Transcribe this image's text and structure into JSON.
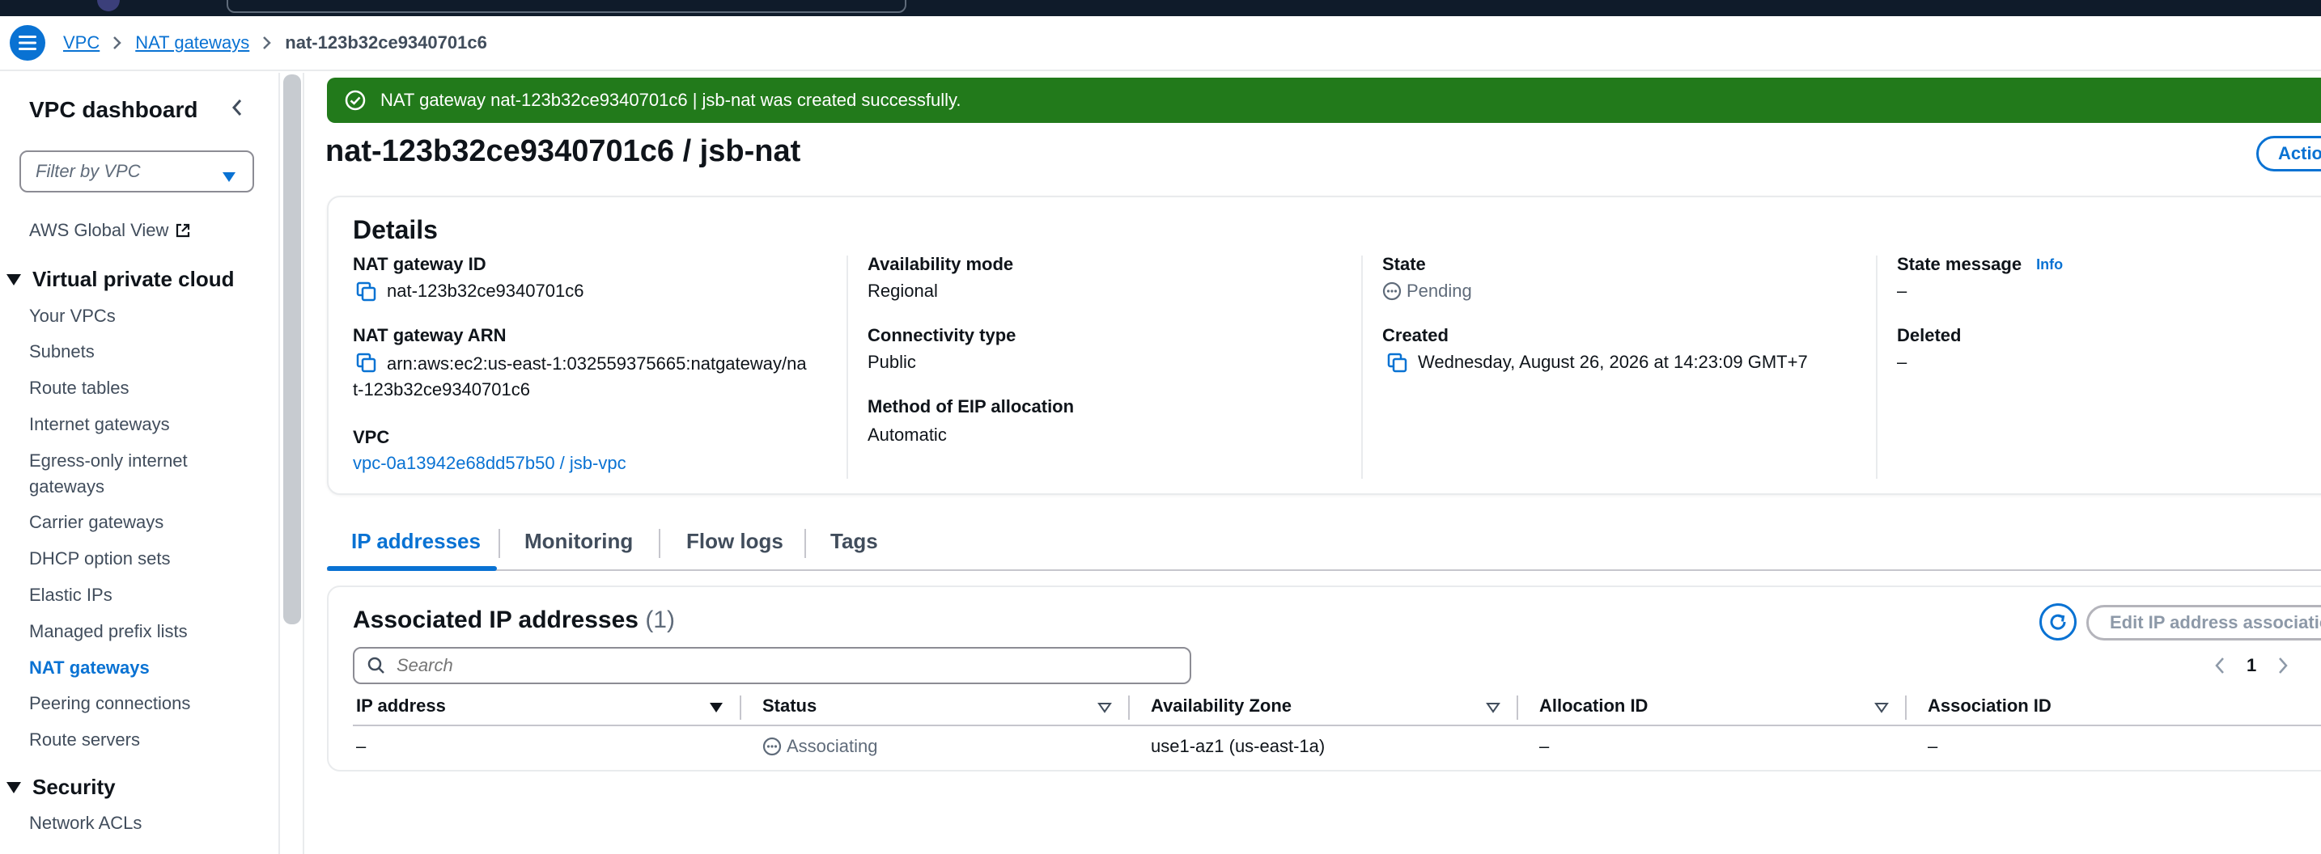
{
  "breadcrumb": {
    "items": [
      "VPC",
      "NAT gateways"
    ],
    "current": "nat-123b32ce9340701c6"
  },
  "sidebar": {
    "title": "VPC dashboard",
    "filter_placeholder": "Filter by VPC",
    "global_view": "AWS Global View",
    "section_vpc": "Virtual private cloud",
    "items": [
      "Your VPCs",
      "Subnets",
      "Route tables",
      "Internet gateways",
      "Egress-only internet",
      "gateways",
      "Carrier gateways",
      "DHCP option sets",
      "Elastic IPs",
      "Managed prefix lists",
      "NAT gateways",
      "Peering connections",
      "Route servers"
    ],
    "section_security": "Security",
    "security_items": [
      "Network ACLs"
    ]
  },
  "flash": {
    "message": "NAT gateway nat-123b32ce9340701c6 | jsb-nat was created successfully."
  },
  "page": {
    "title": "nat-123b32ce9340701c6 / jsb-nat",
    "actions_label": "Actio"
  },
  "details": {
    "title": "Details",
    "nat_id_label": "NAT gateway ID",
    "nat_id": "nat-123b32ce9340701c6",
    "arn_label": "NAT gateway ARN",
    "arn_line1": "arn:aws:ec2:us-east-1:032559375665:natgateway/na",
    "arn_line2": "t-123b32ce9340701c6",
    "vpc_label": "VPC",
    "vpc": "vpc-0a13942e68dd57b50 / jsb-vpc",
    "availability_mode_label": "Availability mode",
    "availability_mode": "Regional",
    "connectivity_label": "Connectivity type",
    "connectivity": "Public",
    "eip_label": "Method of EIP allocation",
    "eip": "Automatic",
    "state_label": "State",
    "state": "Pending",
    "created_label": "Created",
    "created": "Wednesday, August 26, 2026 at 14:23:09 GMT+7",
    "state_message_label": "State message",
    "info": "Info",
    "state_message": "–",
    "deleted_label": "Deleted",
    "deleted": "–"
  },
  "tabs": [
    "IP addresses",
    "Monitoring",
    "Flow logs",
    "Tags"
  ],
  "ip_table": {
    "title": "Associated IP addresses",
    "count": "(1)",
    "edit_label": "Edit IP address associatio",
    "search_placeholder": "Search",
    "page": "1",
    "columns": [
      "IP address",
      "Status",
      "Availability Zone",
      "Allocation ID",
      "Association ID"
    ],
    "rows": [
      {
        "ip": "–",
        "status": "Associating",
        "az": "use1-az1 (us-east-1a)",
        "allocation": "–",
        "association": "–"
      }
    ]
  },
  "colors": {
    "accent": "#0972d3",
    "success": "#227a1b",
    "dark_header": "#0f1b2a"
  }
}
